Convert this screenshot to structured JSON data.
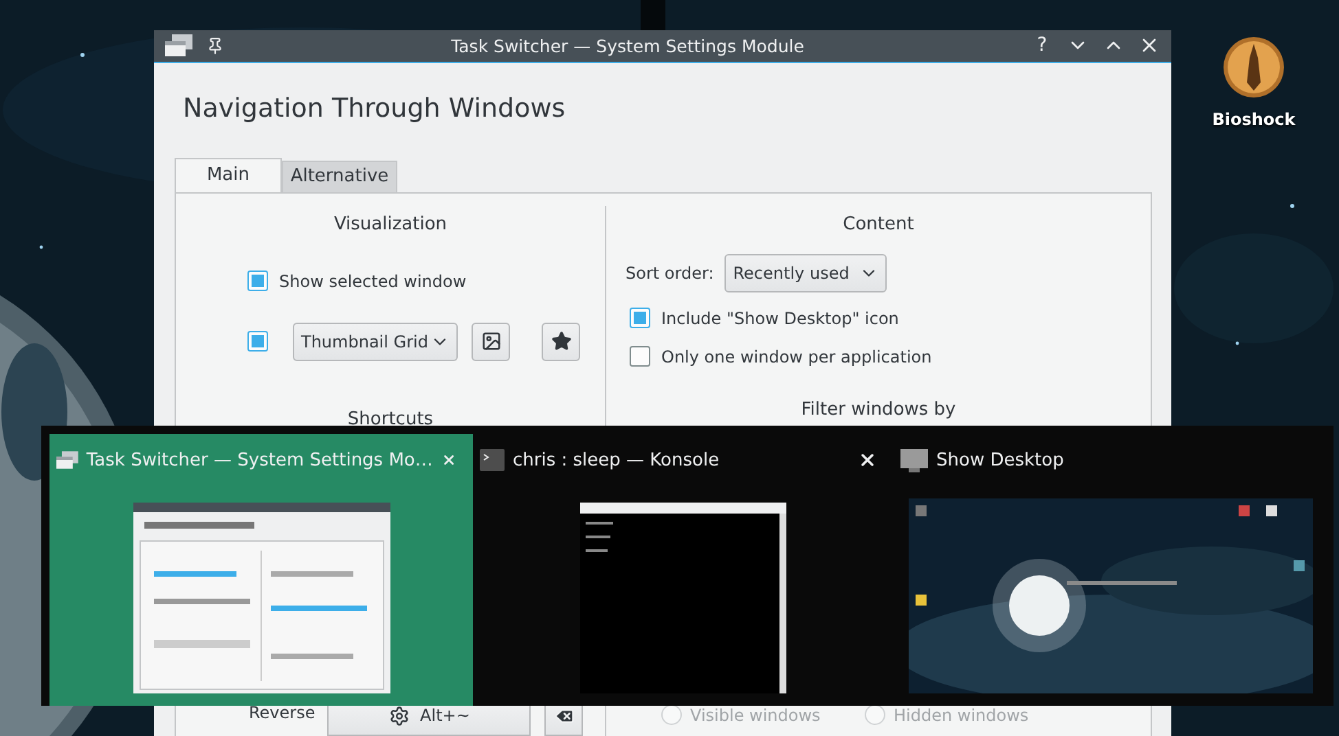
{
  "desktop": {
    "icons": [
      {
        "label": "Bioshock"
      }
    ]
  },
  "window": {
    "title": "Task Switcher — System Settings Module",
    "help": "?",
    "heading": "Navigation Through Windows",
    "tabs": [
      {
        "label": "Main",
        "selected": true
      },
      {
        "label": "Alternative",
        "selected": false
      }
    ],
    "visualization": {
      "title": "Visualization",
      "show_selected": {
        "label": "Show selected window",
        "checked": true
      },
      "layout_enabled": {
        "checked": true
      },
      "layout": {
        "value": "Thumbnail Grid"
      }
    },
    "shortcuts": {
      "title": "Shortcuts",
      "reverse_label": "Reverse",
      "reverse_shortcut": "Alt+~"
    },
    "content": {
      "title": "Content",
      "sort_label": "Sort order:",
      "sort_value": "Recently used",
      "options": [
        {
          "label": "Include \"Show Desktop\" icon",
          "checked": true
        },
        {
          "label": "Only one window per application",
          "checked": false
        }
      ],
      "filter_title": "Filter windows by",
      "radios": [
        {
          "label": "Visible windows",
          "selected": false,
          "disabled": true
        },
        {
          "label": "Hidden windows",
          "selected": false,
          "disabled": true
        }
      ]
    }
  },
  "switcher": {
    "items": [
      {
        "kind": "settings",
        "title": "Task Switcher — System Settings Mo…",
        "selected": true,
        "closable": true
      },
      {
        "kind": "terminal",
        "title": "chris : sleep — Konsole",
        "selected": false,
        "closable": true
      },
      {
        "kind": "desktop",
        "title": "Show Desktop",
        "selected": false,
        "closable": false
      }
    ]
  }
}
